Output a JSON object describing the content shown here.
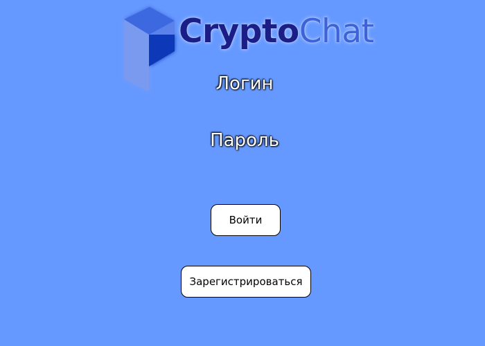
{
  "logo": {
    "text_strong": "Crypto",
    "text_light": "Chat",
    "colors": {
      "strong": "#1a1e86",
      "light": "#3e63d8",
      "mark_front": "#7a9af0",
      "mark_top": "#3c69e0",
      "mark_inner": "#0c38b8"
    }
  },
  "form": {
    "login_label": "Логин",
    "password_label": "Пароль"
  },
  "buttons": {
    "login": "Войти",
    "register": "Зарегистрироваться"
  },
  "theme": {
    "background": "#6699ff"
  }
}
